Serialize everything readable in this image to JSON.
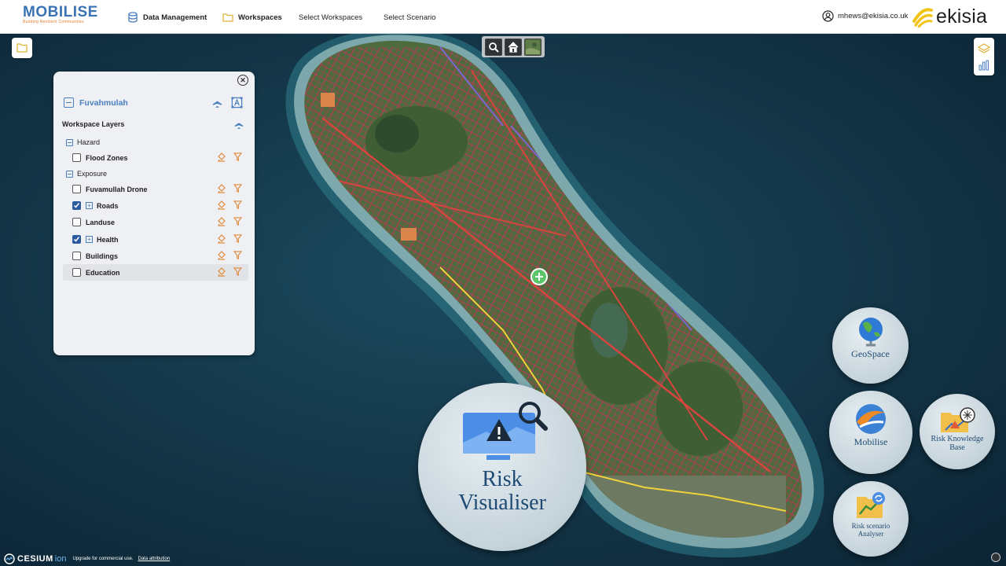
{
  "header": {
    "brand_name": "MOBILISE",
    "brand_tagline": "Building Resilient Communities",
    "nav": {
      "data_management": "Data Management",
      "workspaces": "Workspaces",
      "select_workspaces": "Select Workspaces",
      "select_scenario": "Select Scenario"
    },
    "user_email": "mhews@ekisia.co.uk",
    "partner_logo": "ekisia"
  },
  "panel": {
    "workspace_name": "Fuvahmulah",
    "workspace_layers_title": "Workspace Layers",
    "close_symbol": "✕",
    "groups": {
      "hazard": "Hazard",
      "exposure": "Exposure"
    },
    "layers": {
      "flood_zones": "Flood Zones",
      "drone": "Fuvamullah Drone",
      "roads": "Roads",
      "landuse": "Landuse",
      "health": "Health",
      "buildings": "Buildings",
      "education": "Education"
    }
  },
  "apps": {
    "risk_visualiser_line1": "Risk",
    "risk_visualiser_line2": "Visualiser",
    "geospace": "GeoSpace",
    "mobilise": "Mobilise",
    "risk_kb_line1": "Risk Knowledge",
    "risk_kb_line2": "Base",
    "risk_sa_line1": "Risk scenario",
    "risk_sa_line2": "Analyser"
  },
  "footer": {
    "cesium": "CESIUM",
    "ion": "ion",
    "upgrade": "Upgrade for commercial use.",
    "attribution": "Data attribution"
  },
  "colors": {
    "accent_blue": "#4a7fc0",
    "road_red": "#c8345c",
    "coast_road_yellow": "#f0d23a",
    "ocean": "#0e2a3c",
    "land_green": "#4e6b3e"
  }
}
